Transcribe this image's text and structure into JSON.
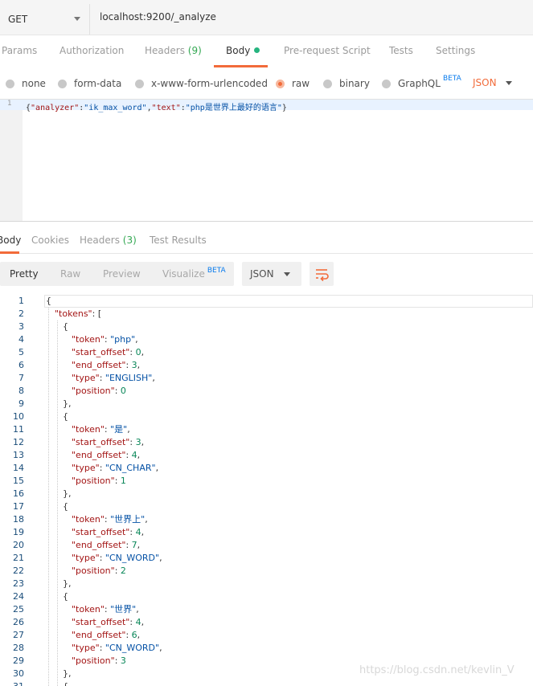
{
  "request": {
    "method": "GET",
    "url": "localhost:9200/_analyze"
  },
  "request_tabs": [
    {
      "label": "Params"
    },
    {
      "label": "Authorization"
    },
    {
      "label": "Headers",
      "count": "(9)"
    },
    {
      "label": "Body"
    },
    {
      "label": "Pre-request Script"
    },
    {
      "label": "Tests"
    },
    {
      "label": "Settings"
    }
  ],
  "body_types": [
    {
      "label": "none"
    },
    {
      "label": "form-data"
    },
    {
      "label": "x-www-form-urlencoded"
    },
    {
      "label": "raw",
      "selected": true
    },
    {
      "label": "binary"
    },
    {
      "label": "GraphQL",
      "badge": "BETA"
    }
  ],
  "body_format": "JSON",
  "request_editor": {
    "line_number": "1",
    "open": "{",
    "k1": "\"analyzer\"",
    "colon1": ":",
    "v1": "\"ik_max_word\"",
    "comma": ",",
    "k2": "\"text\"",
    "colon2": ":",
    "v2": "\"php是世界上最好的语言\"",
    "close": "}"
  },
  "response_tabs": [
    {
      "label": "Body"
    },
    {
      "label": "Cookies"
    },
    {
      "label": "Headers",
      "count": "(3)"
    },
    {
      "label": "Test Results"
    }
  ],
  "view_modes": [
    {
      "label": "Pretty"
    },
    {
      "label": "Raw"
    },
    {
      "label": "Preview"
    },
    {
      "label": "Visualize",
      "badge": "BETA"
    }
  ],
  "response_format": "JSON",
  "icons": {
    "method_dropdown": "chevron-down-icon",
    "format_dropdown": "chevron-down-icon",
    "wrap": "wrap-lines-icon"
  },
  "colors": {
    "accent": "#f26b3a",
    "count": "#34a853",
    "beta": "#097bed",
    "json_key": "#a31515",
    "json_string": "#0451a5",
    "json_number": "#098658"
  },
  "response_lines": [
    {
      "n": "1",
      "text": "{"
    },
    {
      "n": "2",
      "text": "\"tokens\": ["
    },
    {
      "n": "3",
      "text": "{"
    },
    {
      "n": "4",
      "key": "\"token\"",
      "val": "\"php\"",
      "t": "s",
      "end": ","
    },
    {
      "n": "5",
      "key": "\"start_offset\"",
      "val": "0",
      "t": "n",
      "end": ","
    },
    {
      "n": "6",
      "key": "\"end_offset\"",
      "val": "3",
      "t": "n",
      "end": ","
    },
    {
      "n": "7",
      "key": "\"type\"",
      "val": "\"ENGLISH\"",
      "t": "s",
      "end": ","
    },
    {
      "n": "8",
      "key": "\"position\"",
      "val": "0",
      "t": "n",
      "end": ""
    },
    {
      "n": "9",
      "text": "},"
    },
    {
      "n": "10",
      "text": "{"
    },
    {
      "n": "11",
      "key": "\"token\"",
      "val": "\"是\"",
      "t": "s",
      "end": ","
    },
    {
      "n": "12",
      "key": "\"start_offset\"",
      "val": "3",
      "t": "n",
      "end": ","
    },
    {
      "n": "13",
      "key": "\"end_offset\"",
      "val": "4",
      "t": "n",
      "end": ","
    },
    {
      "n": "14",
      "key": "\"type\"",
      "val": "\"CN_CHAR\"",
      "t": "s",
      "end": ","
    },
    {
      "n": "15",
      "key": "\"position\"",
      "val": "1",
      "t": "n",
      "end": ""
    },
    {
      "n": "16",
      "text": "},"
    },
    {
      "n": "17",
      "text": "{"
    },
    {
      "n": "18",
      "key": "\"token\"",
      "val": "\"世界上\"",
      "t": "s",
      "end": ","
    },
    {
      "n": "19",
      "key": "\"start_offset\"",
      "val": "4",
      "t": "n",
      "end": ","
    },
    {
      "n": "20",
      "key": "\"end_offset\"",
      "val": "7",
      "t": "n",
      "end": ","
    },
    {
      "n": "21",
      "key": "\"type\"",
      "val": "\"CN_WORD\"",
      "t": "s",
      "end": ","
    },
    {
      "n": "22",
      "key": "\"position\"",
      "val": "2",
      "t": "n",
      "end": ""
    },
    {
      "n": "23",
      "text": "},"
    },
    {
      "n": "24",
      "text": "{"
    },
    {
      "n": "25",
      "key": "\"token\"",
      "val": "\"世界\"",
      "t": "s",
      "end": ","
    },
    {
      "n": "26",
      "key": "\"start_offset\"",
      "val": "4",
      "t": "n",
      "end": ","
    },
    {
      "n": "27",
      "key": "\"end_offset\"",
      "val": "6",
      "t": "n",
      "end": ","
    },
    {
      "n": "28",
      "key": "\"type\"",
      "val": "\"CN_WORD\"",
      "t": "s",
      "end": ","
    },
    {
      "n": "29",
      "key": "\"position\"",
      "val": "3",
      "t": "n",
      "end": ""
    },
    {
      "n": "30",
      "text": "},"
    },
    {
      "n": "31",
      "text": "{"
    }
  ],
  "watermark": "https://blog.csdn.net/kevlin_V"
}
